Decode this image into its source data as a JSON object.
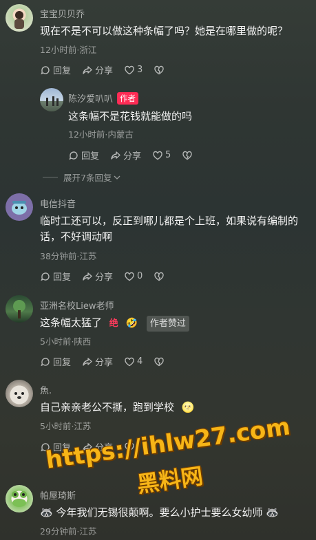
{
  "comments": [
    {
      "user": "宝宝贝贝乔",
      "text": "现在不是不可以做这种条幅了吗？她是在哪里做的呢？",
      "meta": "12小时前·浙江",
      "reply": "回复",
      "share": "分享",
      "likes": "3"
    },
    {
      "user": "陈汐爱叭叭",
      "author_badge": "作者",
      "text": "这条幅不是花钱就能做的吗",
      "meta": "12小时前·内蒙古",
      "reply": "回复",
      "share": "分享",
      "likes": "5"
    },
    {
      "user": "电信抖音",
      "text": "临时工还可以，反正到哪儿都是个上班，如果说有编制的话，不好调动啊",
      "meta": "38分钟前·江苏",
      "reply": "回复",
      "share": "分享",
      "likes": "0"
    },
    {
      "user": "亚洲名校Liew老师",
      "text": "这条幅太猛了",
      "emoji_a": "绝",
      "emoji_b": "🤣",
      "liked_badge": "作者赞过",
      "meta": "5小时前·陕西",
      "reply": "回复",
      "share": "分享",
      "likes": "4"
    },
    {
      "user": "魚.",
      "text": "自己亲亲老公不撕，跑到学校",
      "emoji": "🌝",
      "meta": "5小时前·江苏",
      "reply": "回复",
      "share": "分享"
    },
    {
      "user": "帕屋琦斯",
      "text": "今年我们无锡很颠啊。要么小护士要么女幼师",
      "emoji": "🦝",
      "meta": "29分钟前·江苏"
    }
  ],
  "expand_replies": "展开7条回复",
  "watermark": {
    "url": "https://ihlw27.com",
    "name": "黑料网"
  },
  "colors": {
    "author_badge": "#fe2c55",
    "watermark": "#f7b517"
  }
}
